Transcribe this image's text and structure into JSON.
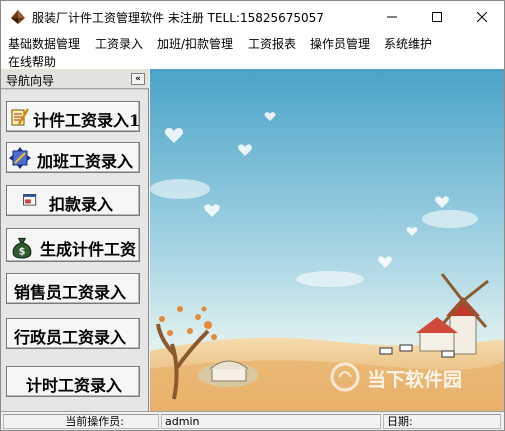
{
  "window": {
    "title": "服装厂计件工资管理软件 未注册 TELL:15825675057"
  },
  "menu": {
    "items": [
      "基础数据管理",
      "工资录入",
      "加班/扣款管理",
      "工资报表",
      "操作员管理",
      "系统维护",
      "在线帮助"
    ]
  },
  "nav": {
    "title": "导航向导",
    "collapse": "«",
    "buttons": [
      "计件工资录入1",
      "加班工资录入",
      "扣款录入",
      "生成计件工资",
      "销售员工资录入",
      "行政员工资录入",
      "计时工资录入"
    ]
  },
  "content": {
    "watermark": "当下软件园"
  },
  "status": {
    "operator_label": "当前操作员:",
    "operator_value": "admin",
    "date_label": "日期:"
  },
  "colors": {
    "sky_top": "#4aa3c8",
    "sky_bottom": "#dff0ef",
    "ground": "#e9b46e"
  }
}
